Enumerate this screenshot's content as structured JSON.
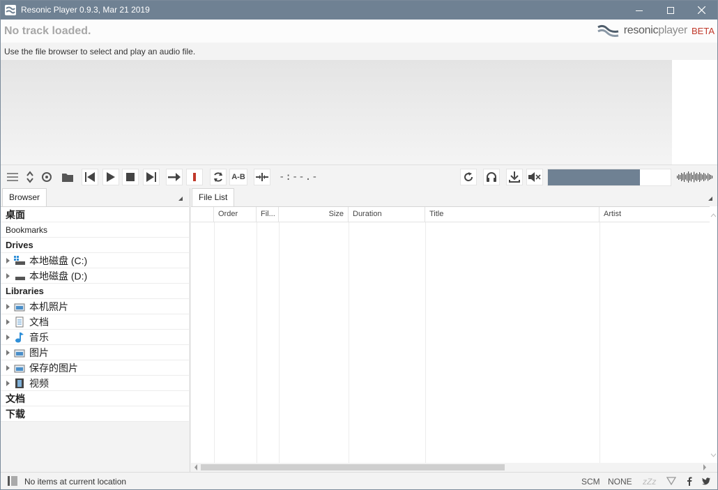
{
  "window": {
    "title": "Resonic Player 0.9.3, Mar 21 2019",
    "minimize_icon": "minimize-icon",
    "maximize_icon": "maximize-icon",
    "close_icon": "close-icon"
  },
  "header": {
    "track_title": "No track loaded.",
    "brand_bold": "resonic",
    "brand_light": "player",
    "brand_beta": "BETA",
    "info": "Use the file browser to select and play an audio file."
  },
  "toolbar": {
    "time": "-:--.-",
    "ab_label": "A-B",
    "volume_fraction": 0.75,
    "accent_color": "#6f8193",
    "stop_marker_color": "#c0392b"
  },
  "browser": {
    "tab_label": "Browser",
    "rows": {
      "desktop": "桌面",
      "bookmarks": "Bookmarks",
      "drives": "Drives",
      "drive_c": "本地磁盘 (C:)",
      "drive_d": "本地磁盘 (D:)",
      "libraries": "Libraries",
      "lib_photos": "本机照片",
      "lib_docs": "文档",
      "lib_music": "音乐",
      "lib_pictures": "图片",
      "lib_saved_pictures": "保存的图片",
      "lib_videos": "视频",
      "documents": "文档",
      "downloads": "下载"
    }
  },
  "file_list": {
    "tab_label": "File List",
    "columns": [
      "",
      "Order",
      "Fil...",
      "Size",
      "Duration",
      "Title",
      "Artist"
    ]
  },
  "status": {
    "text": "No items at current location",
    "scm": "SCM",
    "none": "NONE",
    "sleep": "zZz"
  }
}
